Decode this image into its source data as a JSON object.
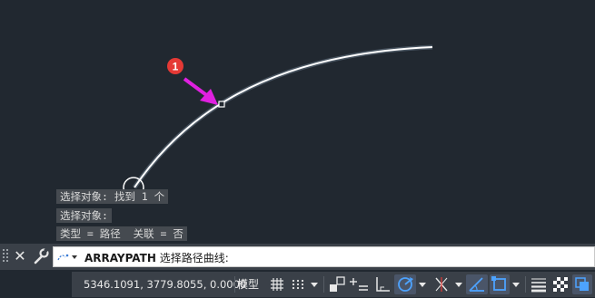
{
  "history": {
    "line1": "选择对象: 找到 1 个",
    "line2": "选择对象:",
    "line3": "类型 = 路径  关联 = 否"
  },
  "marker": {
    "number": "1"
  },
  "command": {
    "name": "ARRAYPATH",
    "prompt": " 选择路径曲线:"
  },
  "status": {
    "coordinates": "5346.1091, 3779.8055, 0.0000",
    "model": "模型"
  },
  "colors": {
    "canvas": "#212830",
    "callout_arrow": "#e020e0",
    "marker_badge": "#e53935",
    "active_icon": "#4da3ff"
  }
}
